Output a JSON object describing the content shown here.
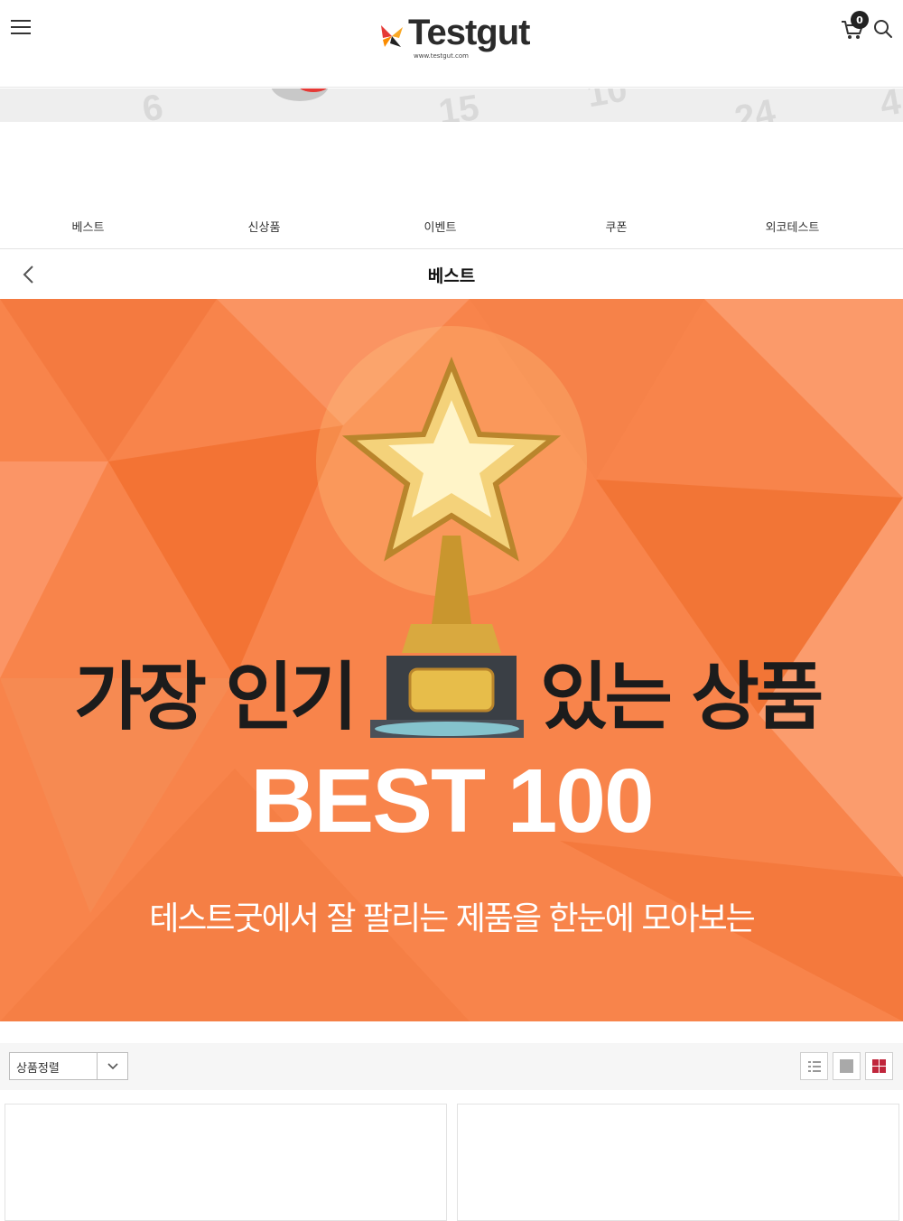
{
  "header": {
    "logo_text": "Testgut",
    "logo_url": "www.testgut.com",
    "cart_count": "0"
  },
  "slim_banner": {
    "numbers": [
      "6",
      "15",
      "10",
      "24",
      "4"
    ]
  },
  "tabs": [
    {
      "label": "베스트"
    },
    {
      "label": "신상품"
    },
    {
      "label": "이벤트"
    },
    {
      "label": "쿠폰"
    },
    {
      "label": "외코테스트"
    }
  ],
  "page": {
    "title": "베스트"
  },
  "hero": {
    "title_left": "가장 인기",
    "title_right": "있는 상품",
    "best": "BEST 100",
    "subtitle": "테스트굿에서 잘 팔리는 제품을 한눈에 모아보는"
  },
  "toolbar": {
    "sort_label": "상품정렬"
  },
  "colors": {
    "hero_orange": "#f8844b",
    "accent_red": "#c0253b"
  }
}
